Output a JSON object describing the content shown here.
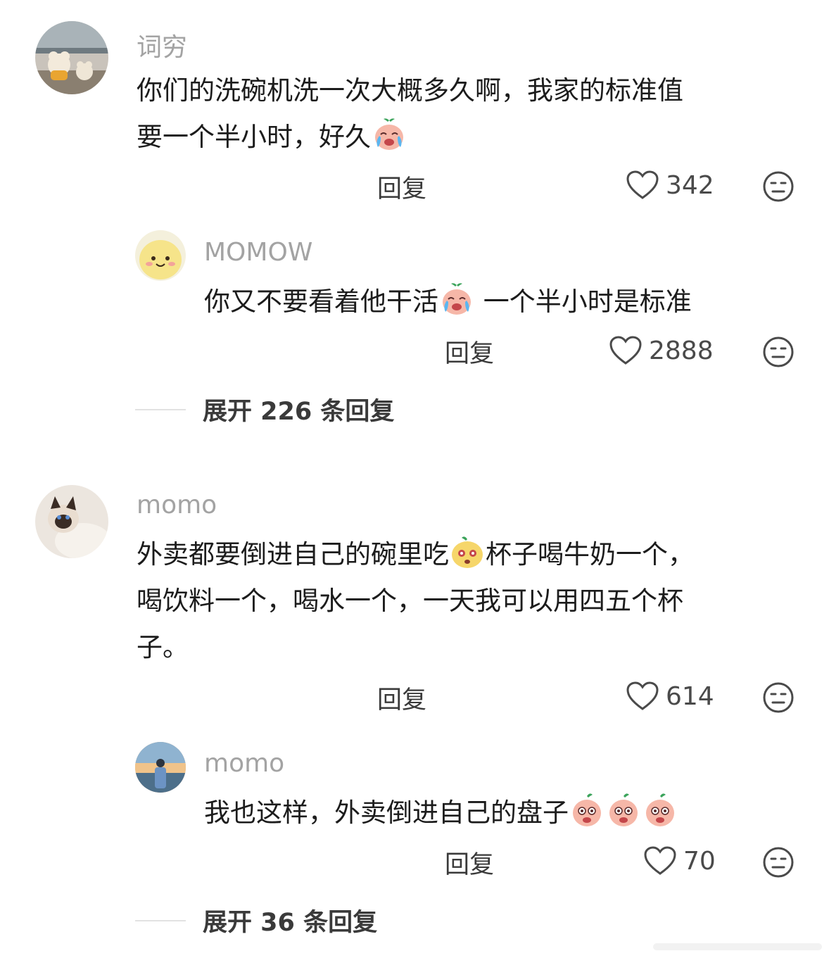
{
  "comments": [
    {
      "username": "词穷",
      "text_line1": "你们的洗碗机洗一次大概多久啊，我家的标准值",
      "text_line2": "要一个半小时，好久",
      "emoji": "crying-face-emoji",
      "reply_label": "回复",
      "likes": "342",
      "replies": [
        {
          "username": "MOMOW",
          "text_part1": "你又不要看着他干活",
          "emoji": "crying-face-emoji",
          "text_part2": " 一个半小时是标准",
          "reply_label": "回复",
          "likes": "2888"
        }
      ],
      "expand_label": "展开 226 条回复"
    },
    {
      "username": "momo",
      "text_line1_part1": "外卖都要倒进自己的碗里吃",
      "emoji": "blushing-face-emoji",
      "text_line1_part2": "杯子喝牛奶一个，",
      "text_line2": "喝饮料一个，喝水一个，一天我可以用四五个杯",
      "text_line3": "子。",
      "reply_label": "回复",
      "likes": "614",
      "replies": [
        {
          "username": "momo",
          "text": "我也这样，外卖倒进自己的盘子",
          "emojis": [
            "surprised-face-emoji",
            "surprised-face-emoji",
            "surprised-face-emoji"
          ],
          "reply_label": "回复",
          "likes": "70"
        }
      ],
      "expand_label": "展开 36 条回复"
    }
  ],
  "colors": {
    "username": "#a3a3a3",
    "text": "#1c1c1c",
    "action": "#3a3a3a",
    "icon": "#4a4a4a"
  }
}
